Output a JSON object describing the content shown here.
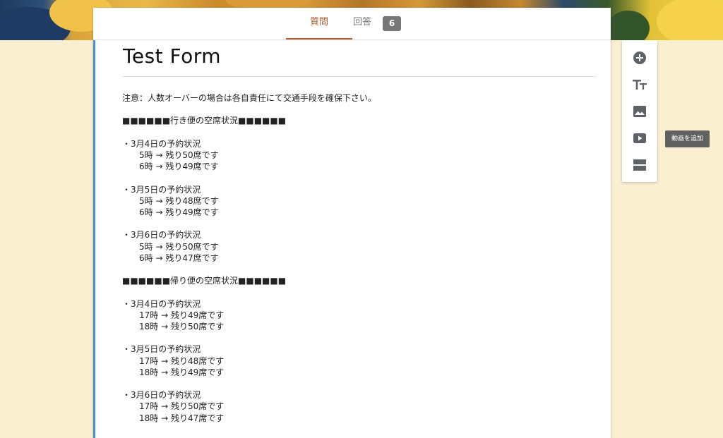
{
  "tabs": {
    "questions_label": "質問",
    "responses_label": "回答",
    "responses_count": "6"
  },
  "form": {
    "title": "Test Form",
    "description": "注意：人数オーバーの場合は各自責任にて交通手段を確保下さい。\n\n■■■■■■行き便の空席状況■■■■■■\n\n・3月4日の予約状況\n　　5時 → 残り50席です\n　　6時 → 残り49席です\n\n・3月5日の予約状況\n　　5時 → 残り48席です\n　　6時 → 残り49席です\n\n・3月6日の予約状況\n　　5時 → 残り50席です\n　　6時 → 残り47席です\n\n■■■■■■帰り便の空席状況■■■■■■\n\n・3月4日の予約状況\n　　17時 → 残り49席です\n　　18時 → 残り50席です\n\n・3月5日の予約状況\n　　17時 → 残り48席です\n　　18時 → 残り49席です\n\n・3月6日の予約状況\n　　17時 → 残り50席です\n　　18時 → 残り47席です"
  },
  "toolbar": {
    "items": [
      "add-question-icon",
      "add-title-icon",
      "add-image-icon",
      "add-video-icon",
      "add-section-icon"
    ],
    "tooltip": "動画を追加"
  },
  "colors": {
    "accent": "#b5572a",
    "left_border": "#4a8de0",
    "background": "#fbefd2"
  }
}
